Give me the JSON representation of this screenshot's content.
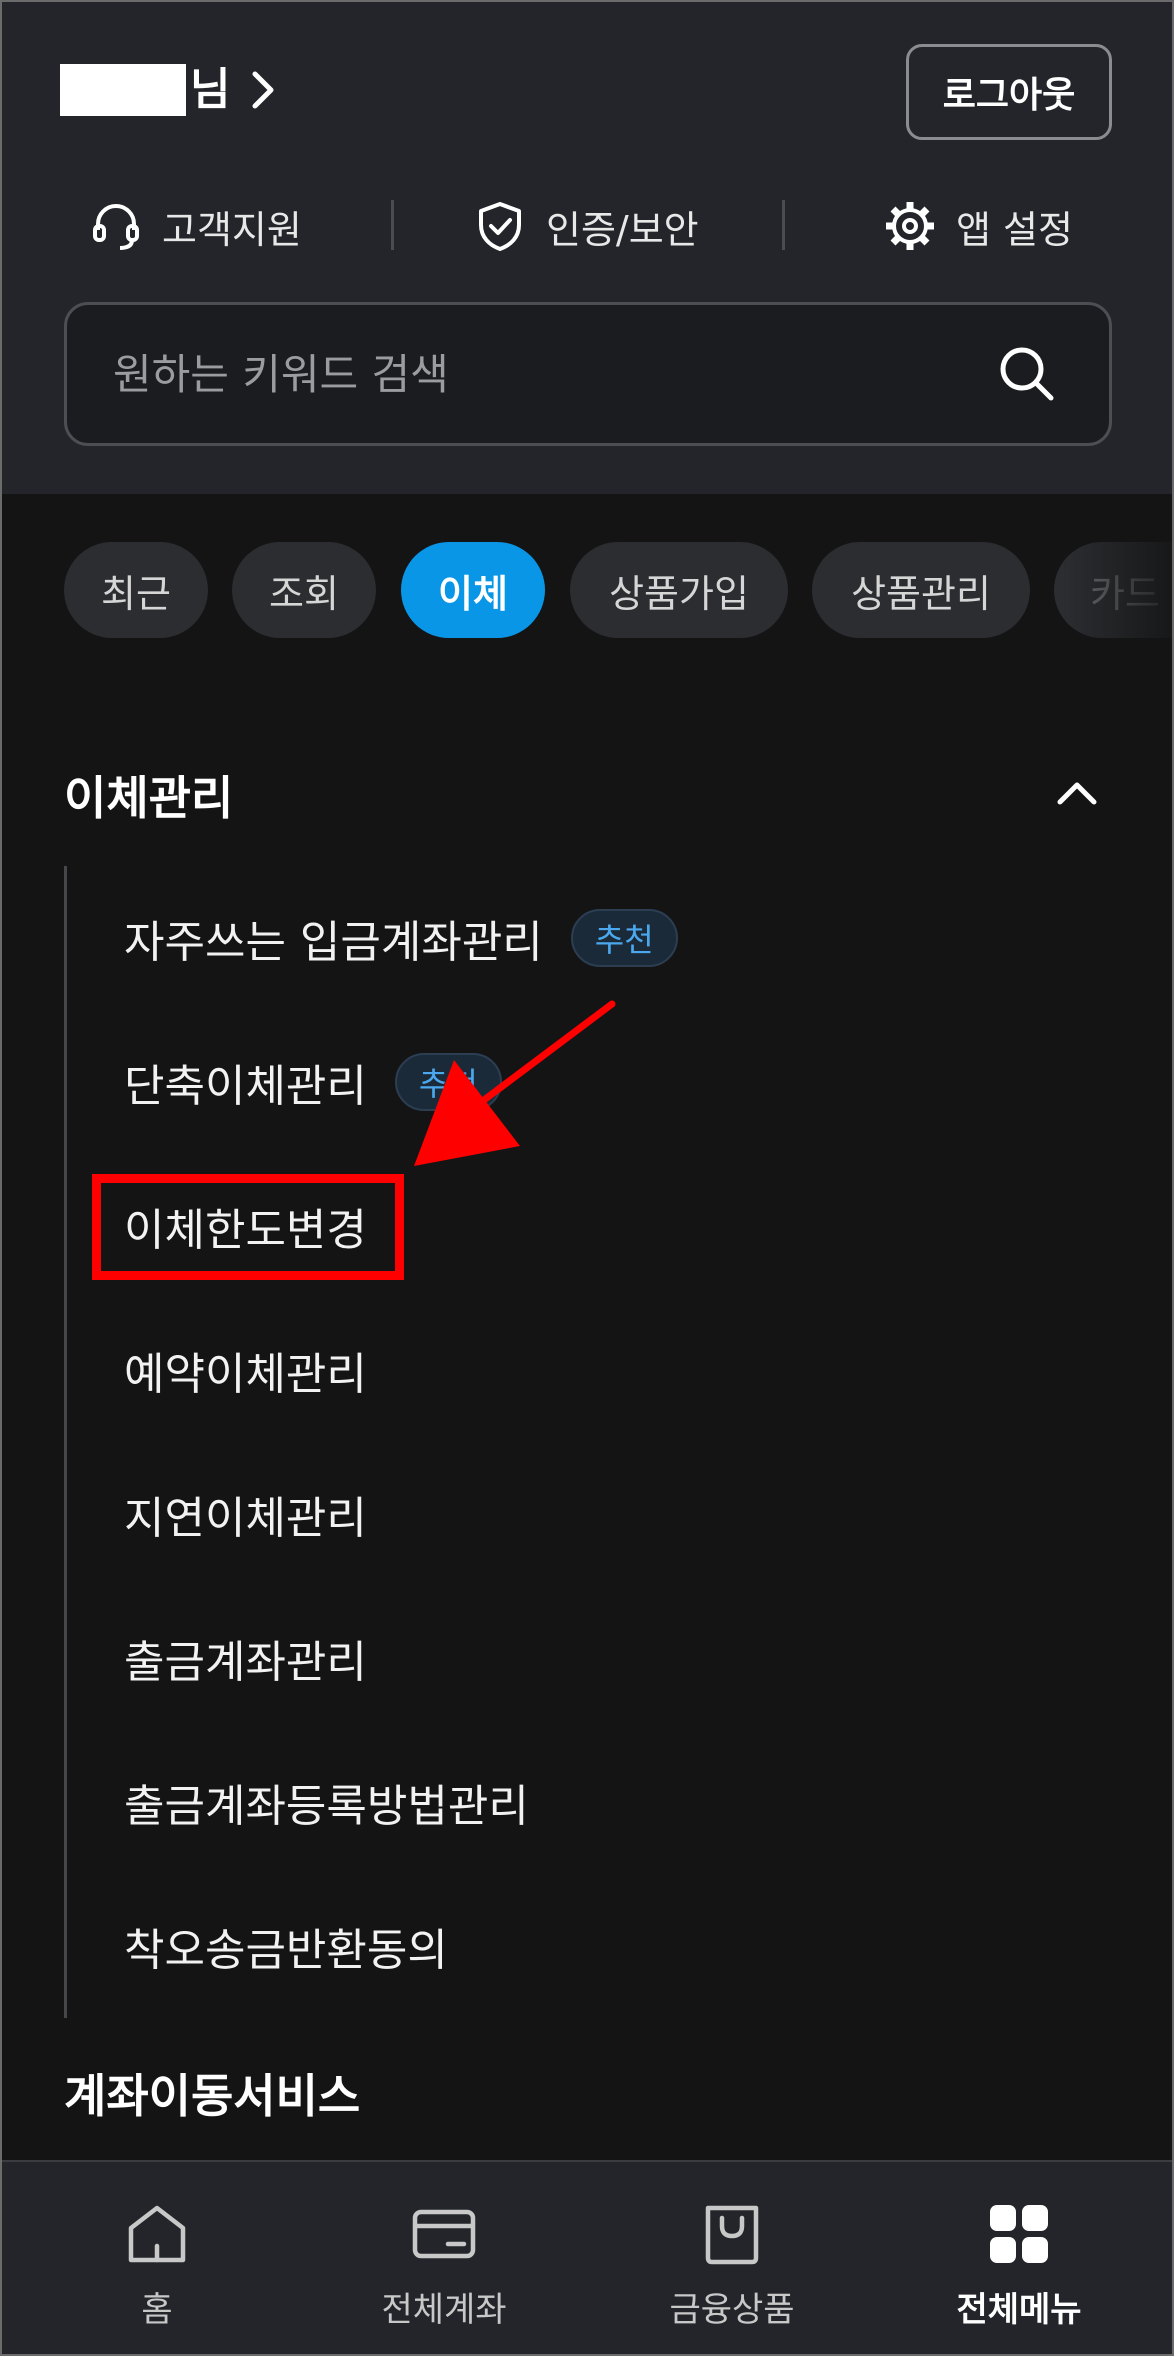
{
  "header": {
    "honorific": "님",
    "logout_label": "로그아웃",
    "quick_links": [
      {
        "label": "고객지원",
        "icon": "headset-icon"
      },
      {
        "label": "인증/보안",
        "icon": "shield-check-icon"
      },
      {
        "label": "앱 설정",
        "icon": "gear-icon"
      }
    ],
    "search": {
      "placeholder": "원하는 키워드 검색",
      "value": ""
    }
  },
  "categories": {
    "chips": [
      "최근",
      "조회",
      "이체",
      "상품가입",
      "상품관리",
      "카드"
    ],
    "active": "이체"
  },
  "sections": [
    {
      "title": "이체관리",
      "expanded": true,
      "items": [
        {
          "label": "자주쓰는 입금계좌관리",
          "badge": "추천"
        },
        {
          "label": "단축이체관리",
          "badge": "추천"
        },
        {
          "label": "이체한도변경",
          "highlighted": true
        },
        {
          "label": "예약이체관리"
        },
        {
          "label": "지연이체관리"
        },
        {
          "label": "출금계좌관리"
        },
        {
          "label": "출금계좌등록방법관리"
        },
        {
          "label": "착오송금반환동의"
        }
      ]
    },
    {
      "title": "계좌이동서비스"
    }
  ],
  "bottom_nav": [
    {
      "label": "홈",
      "icon": "home-icon"
    },
    {
      "label": "전체계좌",
      "icon": "card-icon"
    },
    {
      "label": "금융상품",
      "icon": "shopping-bag-icon"
    },
    {
      "label": "전체메뉴",
      "icon": "grid-menu-icon",
      "active": true
    }
  ],
  "colors": {
    "accent": "#0a96e6",
    "annotation": "#ff0000",
    "badge_text": "#4ba8ee",
    "header_bg": "#23252a",
    "body_bg": "#141414"
  }
}
